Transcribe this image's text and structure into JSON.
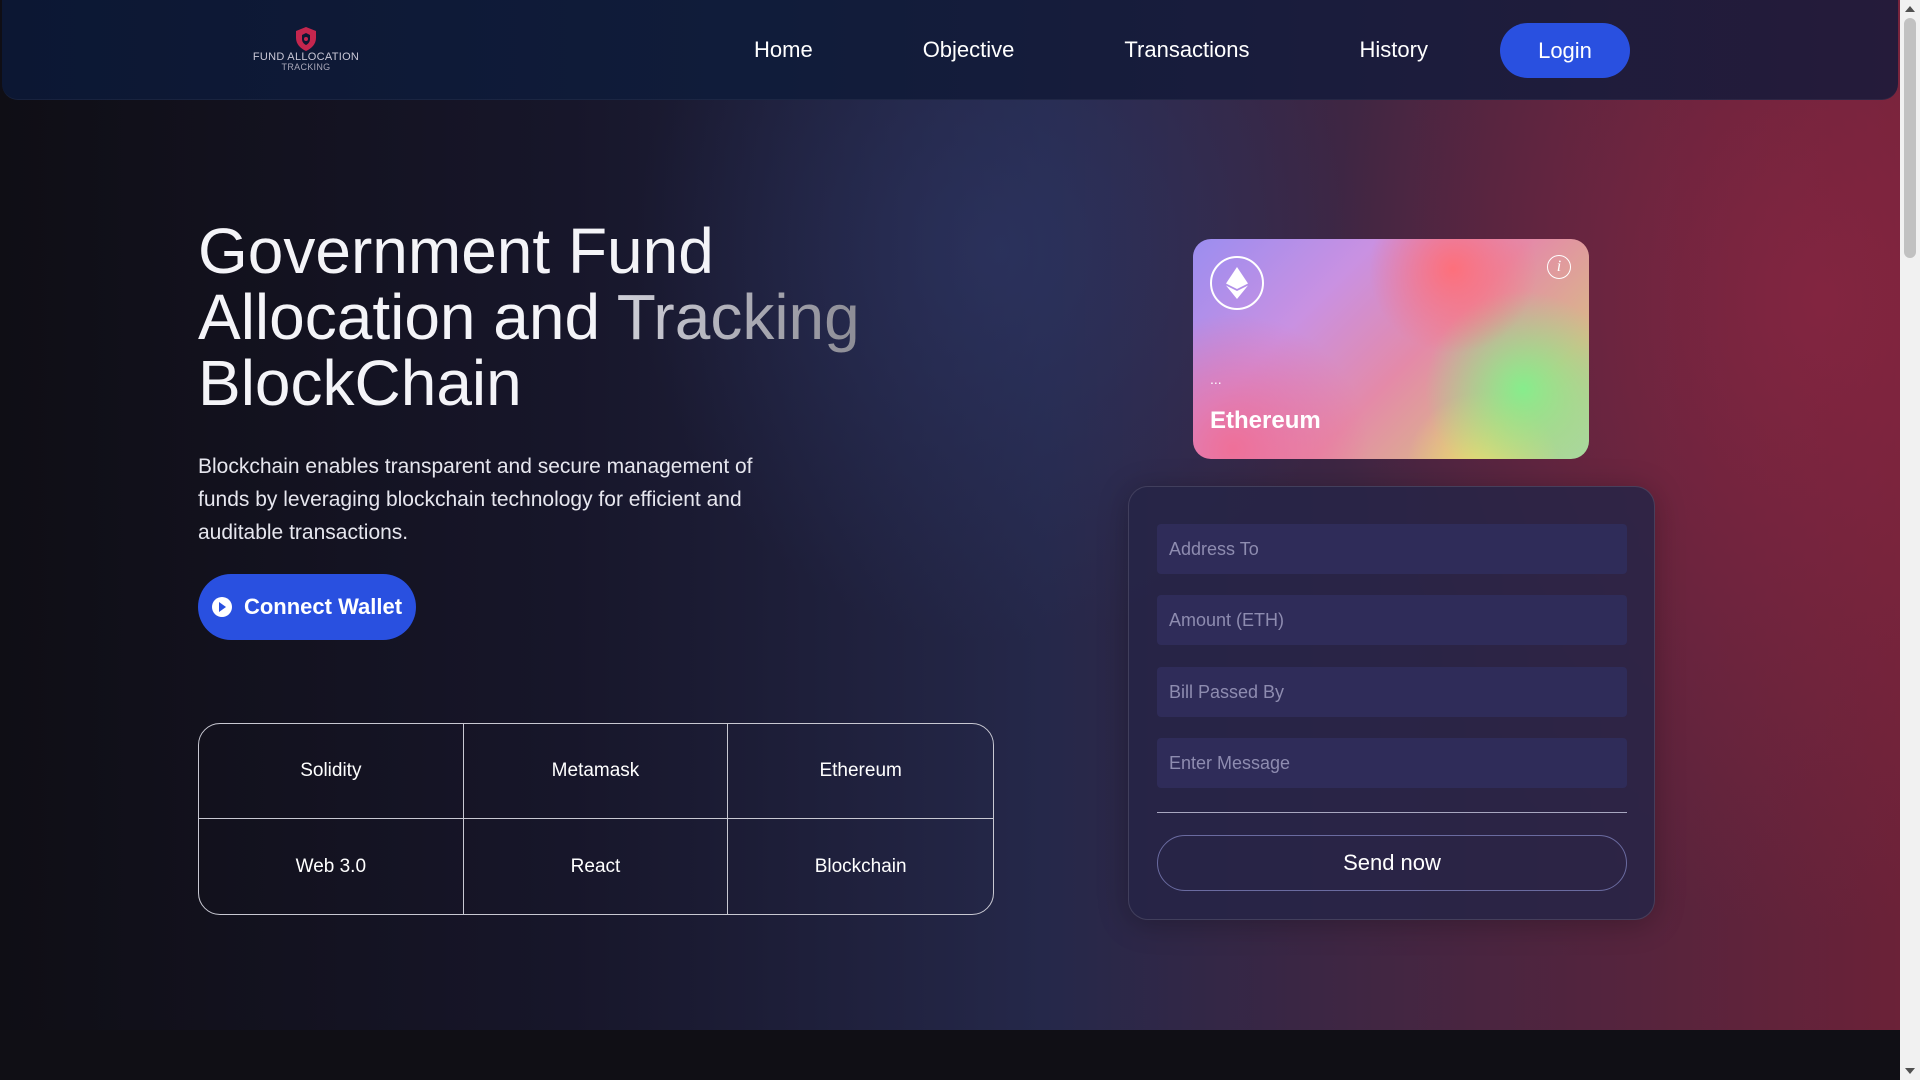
{
  "brand": {
    "logo_line1": "FUND ALLOCATION",
    "logo_line2": "TRACKING",
    "logo_icon": "shield-icon",
    "accent_color": "#2950e0"
  },
  "nav": {
    "items": [
      {
        "label": "Home"
      },
      {
        "label": "Objective"
      },
      {
        "label": "Transactions"
      },
      {
        "label": "History"
      }
    ],
    "login_label": "Login"
  },
  "hero": {
    "title_part1": "Government Fund Allocation and ",
    "title_fade": "Tracking",
    "title_part2": "BlockChain",
    "subtitle": "Blockchain enables transparent and secure management of funds by leveraging blockchain technology for efficient and auditable transactions.",
    "connect_label": "Connect Wallet"
  },
  "tech": {
    "items": [
      "Solidity",
      "Metamask",
      "Ethereum",
      "Web 3.0",
      "React",
      "Blockchain"
    ]
  },
  "card": {
    "address": "...",
    "label": "Ethereum",
    "logo_icon": "ethereum-icon",
    "info_icon": "info-icon"
  },
  "form": {
    "address_placeholder": "Address To",
    "amount_placeholder": "Amount (ETH)",
    "bill_placeholder": "Bill Passed By",
    "message_placeholder": "Enter Message",
    "send_label": "Send now"
  }
}
